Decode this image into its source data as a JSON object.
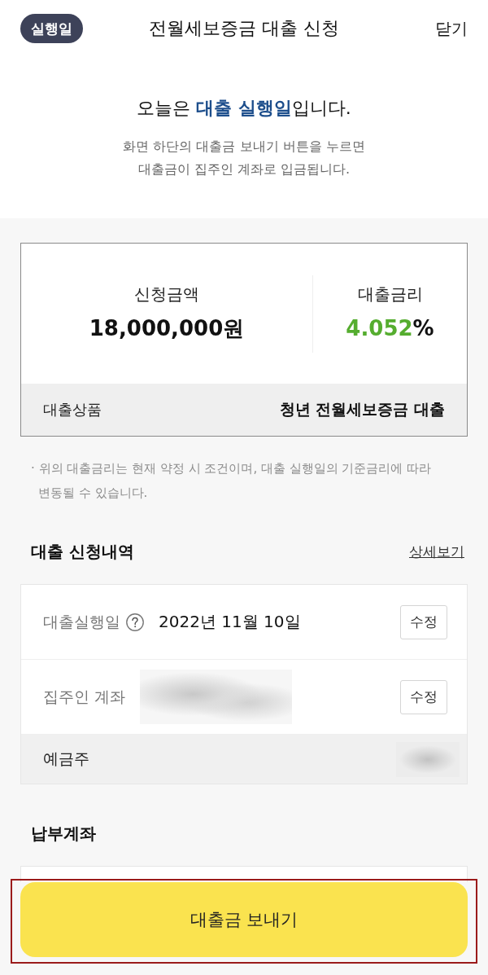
{
  "header": {
    "badge": "실행일",
    "title": "전월세보증금 대출 신청",
    "close": "닫기"
  },
  "intro": {
    "headline": "오늘은 **대출 실행일**입니다.",
    "description_lines": [
      "화면 하단의 대출금 보내기 버튼을 누르면",
      "대출금이 집주인 계좌로 입금됩니다."
    ]
  },
  "summary": {
    "amount_label": "신청금액",
    "amount": "18,000,000원",
    "rate_label": "대출금리",
    "rate_value": "4.052",
    "rate_unit": "%",
    "product_label": "대출상품",
    "product": "청년 전월세보증금 대출"
  },
  "note": "· 위의 대출금리는 현재 약정 시 조건이며, 대출 실행일의 기준금리에 따라 변동될 수 있습니다.",
  "application": {
    "title": "대출 신청내역",
    "link": "상세보기",
    "rows": [
      {
        "kind": "date",
        "label": "대출실행일",
        "help": true,
        "value": "2022년 11월 10일",
        "redacted": false,
        "action": "수정"
      },
      {
        "kind": "account",
        "label": "집주인 계좌",
        "help": false,
        "redacted": true,
        "action": "수정"
      },
      {
        "kind": "holder",
        "label": "예금주",
        "help": false,
        "redacted": true
      }
    ]
  },
  "payment": {
    "title": "납부계좌"
  },
  "bottom": {
    "button": "대출금 보내기",
    "highlighted": true
  }
}
